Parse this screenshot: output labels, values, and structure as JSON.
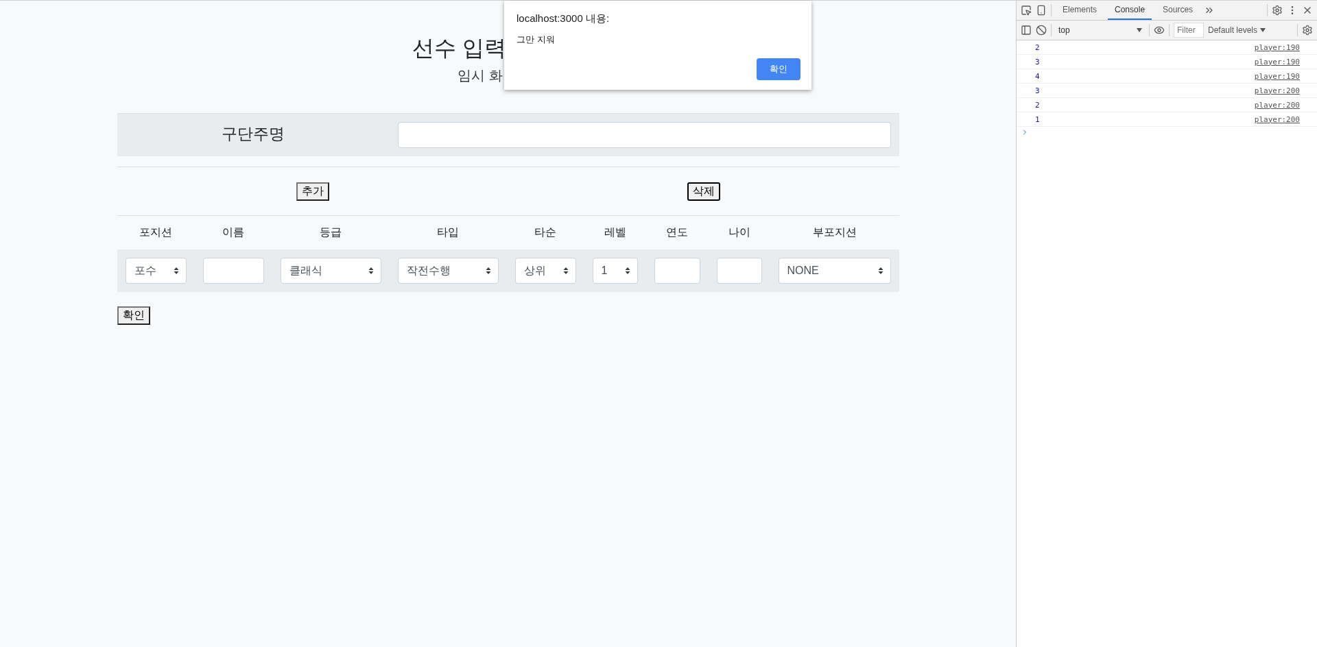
{
  "page": {
    "title": "선수 입력",
    "subtitle": "임시 화"
  },
  "team_field": {
    "label": "구단주명"
  },
  "actions": [
    {
      "label": "추가",
      "focused": false
    },
    {
      "label": "삭제",
      "focused": true
    }
  ],
  "columns": [
    "포지션",
    "이름",
    "등급",
    "타입",
    "타순",
    "레벨",
    "연도",
    "나이",
    "부포지션"
  ],
  "row": [
    {
      "kind": "select",
      "value": "포수"
    },
    {
      "kind": "input"
    },
    {
      "kind": "select",
      "value": "클래식"
    },
    {
      "kind": "select",
      "value": "작전수행"
    },
    {
      "kind": "select",
      "value": "상위"
    },
    {
      "kind": "select",
      "value": "1"
    },
    {
      "kind": "input"
    },
    {
      "kind": "input"
    },
    {
      "kind": "select",
      "value": "NONE"
    }
  ],
  "confirm_button": "확인",
  "alert": {
    "origin": "localhost:3000 내용:",
    "message": "그만 지워",
    "button": "확인"
  },
  "devtools": {
    "tabs": [
      {
        "label": "Elements",
        "selected": false
      },
      {
        "label": "Console",
        "selected": true
      },
      {
        "label": "Sources",
        "selected": false
      }
    ],
    "context": "top",
    "filter_placeholder": "Filter",
    "levels": "Default levels",
    "logs": [
      {
        "value": "2",
        "source": "player:190"
      },
      {
        "value": "3",
        "source": "player:190"
      },
      {
        "value": "4",
        "source": "player:190"
      },
      {
        "value": "3",
        "source": "player:200"
      },
      {
        "value": "2",
        "source": "player:200"
      },
      {
        "value": "1",
        "source": "player:200"
      }
    ]
  }
}
